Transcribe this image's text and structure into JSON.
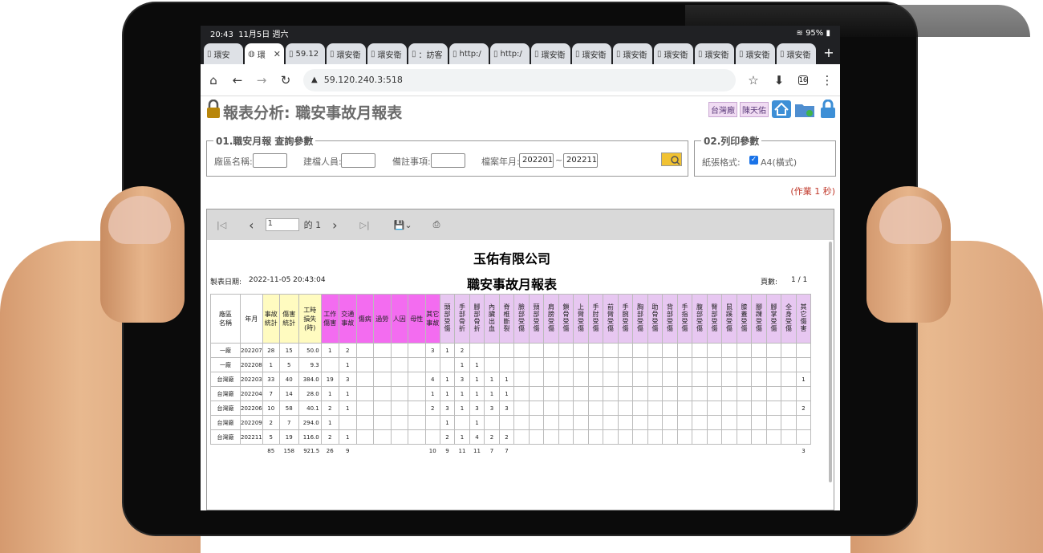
{
  "status": {
    "time": "20:43",
    "date": "11月5日 週六",
    "battery": "95%"
  },
  "tabs": [
    {
      "label": "環安",
      "active": false
    },
    {
      "label": "環",
      "active": true
    },
    {
      "label": "59.12",
      "active": false
    },
    {
      "label": "環安衛",
      "active": false
    },
    {
      "label": "環安衛",
      "active": false
    },
    {
      "label": "：訪客",
      "active": false
    },
    {
      "label": "http:/",
      "active": false
    },
    {
      "label": "http:/",
      "active": false
    },
    {
      "label": "環安衛",
      "active": false
    },
    {
      "label": "環安衛",
      "active": false
    },
    {
      "label": "環安衛",
      "active": false
    },
    {
      "label": "環安衛",
      "active": false
    },
    {
      "label": "環安衛",
      "active": false
    },
    {
      "label": "環安衛",
      "active": false
    },
    {
      "label": "環安衛",
      "active": false
    }
  ],
  "browser": {
    "url": "59.120.240.3:518",
    "tab_count": "16"
  },
  "page": {
    "title": "報表分析: 職安事故月報表",
    "factory_badge": "台灣廠",
    "user_badge": "陳天佑"
  },
  "query": {
    "legend": "01.職安月報 查詢參數",
    "factory_label": "廠區名稱:",
    "factory_value": "",
    "creator_label": "建檔人員:",
    "creator_value": "",
    "note_label": "備註事項:",
    "note_value": "",
    "period_label": "檔案年月:",
    "period_from": "202201",
    "period_sep": "~",
    "period_to": "202211"
  },
  "print": {
    "legend": "02.列印參數",
    "paper_label": "紙張格式:",
    "paper_option": "A4(橫式)",
    "paper_checked": true
  },
  "time_note": "(作業 1 秒)",
  "viewer": {
    "page_value": "1",
    "page_of": "的 1"
  },
  "report": {
    "company": "玉佑有限公司",
    "title": "職安事故月報表",
    "date_label": "製表日期:",
    "date_value": "2022-11-05 20:43:04",
    "page_label": "頁數:",
    "page_value": "1 / 1",
    "headers": [
      "廠區\n名稱",
      "年月",
      "事故\n統計",
      "傷害\n統計",
      "工時\n損失\n(時)",
      "工作\n傷害",
      "交通\n事故",
      "傷病",
      "過勞",
      "人因",
      "母性",
      "其它\n事故",
      "頭部受傷",
      "手部骨折",
      "腳部骨折",
      "內臟出血",
      "脊椎斷裂",
      "臉部受傷",
      "頸部受傷",
      "肩膀受傷",
      "鎖骨受傷",
      "上臂受傷",
      "手肘受傷",
      "前臂受傷",
      "手腕受傷",
      "胸部受傷",
      "助骨受傷",
      "背部受傷",
      "手指受傷",
      "腹部受傷",
      "臀部受傷",
      "鼠蹊受傷",
      "膝蓋受傷",
      "腳踝受傷",
      "腳掌受傷",
      "全身受傷",
      "其它傷害"
    ],
    "rows": [
      [
        "一廠",
        "202207",
        "28",
        "15",
        "50.0",
        "1",
        "2",
        "",
        "",
        "",
        "",
        "3",
        "1",
        "2",
        "",
        "",
        "",
        "",
        "",
        "",
        "",
        "",
        "",
        "",
        "",
        "",
        "",
        "",
        "",
        "",
        "",
        "",
        "",
        "",
        "",
        "",
        ""
      ],
      [
        "一廠",
        "202208",
        "1",
        "5",
        "9.3",
        "",
        "1",
        "",
        "",
        "",
        "",
        "",
        "",
        "1",
        "1",
        "",
        "",
        "",
        "",
        "",
        "",
        "",
        "",
        "",
        "",
        "",
        "",
        "",
        "",
        "",
        "",
        "",
        "",
        "",
        "",
        "",
        ""
      ],
      [
        "台灣廠",
        "202203",
        "33",
        "40",
        "384.0",
        "19",
        "3",
        "",
        "",
        "",
        "",
        "4",
        "1",
        "3",
        "1",
        "1",
        "1",
        "",
        "",
        "",
        "",
        "",
        "",
        "",
        "",
        "",
        "",
        "",
        "",
        "",
        "",
        "",
        "",
        "",
        "",
        "",
        "1"
      ],
      [
        "台灣廠",
        "202204",
        "7",
        "14",
        "28.0",
        "1",
        "1",
        "",
        "",
        "",
        "",
        "1",
        "1",
        "1",
        "1",
        "1",
        "1",
        "",
        "",
        "",
        "",
        "",
        "",
        "",
        "",
        "",
        "",
        "",
        "",
        "",
        "",
        "",
        "",
        "",
        "",
        "",
        ""
      ],
      [
        "台灣廠",
        "202206",
        "10",
        "58",
        "40.1",
        "2",
        "1",
        "",
        "",
        "",
        "",
        "2",
        "3",
        "1",
        "3",
        "3",
        "3",
        "",
        "",
        "",
        "",
        "",
        "",
        "",
        "",
        "",
        "",
        "",
        "",
        "",
        "",
        "",
        "",
        "",
        "",
        "",
        "2"
      ],
      [
        "台灣廠",
        "202209",
        "2",
        "7",
        "294.0",
        "1",
        "",
        "",
        "",
        "",
        "",
        "",
        "1",
        "",
        "1",
        "",
        "",
        "",
        "",
        "",
        "",
        "",
        "",
        "",
        "",
        "",
        "",
        "",
        "",
        "",
        "",
        "",
        "",
        "",
        "",
        "",
        ""
      ],
      [
        "台灣廠",
        "202211",
        "5",
        "19",
        "116.0",
        "2",
        "1",
        "",
        "",
        "",
        "",
        "",
        "2",
        "1",
        "4",
        "2",
        "2",
        "",
        "",
        "",
        "",
        "",
        "",
        "",
        "",
        "",
        "",
        "",
        "",
        "",
        "",
        "",
        "",
        "",
        "",
        "",
        ""
      ]
    ],
    "totals": [
      "",
      "",
      "85",
      "158",
      "921.5",
      "26",
      "9",
      "",
      "",
      "",
      "",
      "10",
      "9",
      "11",
      "11",
      "7",
      "7",
      "",
      "",
      "",
      "",
      "",
      "",
      "",
      "",
      "",
      "",
      "",
      "",
      "",
      "",
      "",
      "",
      "",
      "",
      "",
      "3"
    ]
  },
  "colors": {
    "accent_magenta": "#f36cf0",
    "lavender": "#e7c7f1",
    "yellow": "#fffbc0",
    "alert": "#c0392b"
  }
}
